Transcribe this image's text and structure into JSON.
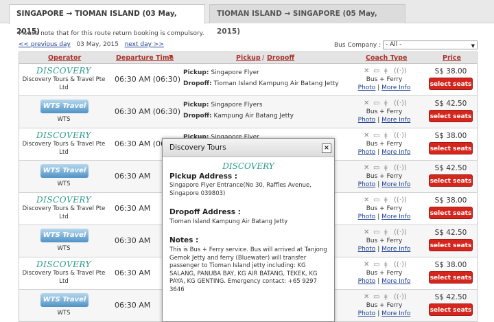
{
  "tabs": [
    {
      "label": "SINGAPORE → TIOMAN ISLAND (03 May, 2015)",
      "active": true
    },
    {
      "label": "TIOMAN ISLAND → SINGAPORE (05 May, 2015)",
      "active": false
    }
  ],
  "notice": "Please note that for this route return booking is compulsory.",
  "date_nav": {
    "prev": "<< previous day",
    "current": "03 May, 2015",
    "next": "next day >>"
  },
  "filter": {
    "label": "Bus Company :",
    "selected": "- All -"
  },
  "headers": {
    "operator": "Operator",
    "departure": "Departure Time",
    "pickup": "Pickup",
    "separator": "/",
    "dropoff": "Dropoff",
    "coach": "Coach Type",
    "price": "Price"
  },
  "labels": {
    "pickup": "Pickup:",
    "dropoff": "Dropoff:",
    "photo": "Photo",
    "more": "More Info",
    "divider": "|",
    "select": "select seats"
  },
  "rows": [
    {
      "logo": "DISCOVERY",
      "operator": "Discovery Tours & Travel Pte Ltd",
      "time": "06:30 AM (06:30)",
      "pickup": "Singapore Flyer",
      "dropoff": "Tioman Island Kampung Air Batang Jetty",
      "coach": "Bus + Ferry",
      "price": "S$ 38.00"
    },
    {
      "logo": "WTSTravel",
      "operator": "WTS",
      "time": "06:30 AM (06:30)",
      "pickup": "Singapore Flyers",
      "dropoff": "Kampung Air Batang Jetty",
      "coach": "Bus + Ferry",
      "price": "S$ 42.50"
    },
    {
      "logo": "DISCOVERY",
      "operator": "Discovery Tours & Travel Pte Ltd",
      "time": "06:30 AM (06:30)",
      "pickup": "Singapore Flyer",
      "dropoff": "",
      "coach": "Bus + Ferry",
      "price": "S$ 38.00"
    },
    {
      "logo": "WTSTravel",
      "operator": "WTS",
      "time": "06:30 AM",
      "pickup": "",
      "dropoff": "",
      "coach": "Bus + Ferry",
      "price": "S$ 42.50"
    },
    {
      "logo": "DISCOVERY",
      "operator": "Discovery Tours & Travel Pte Ltd",
      "time": "06:30 AM",
      "pickup": "",
      "dropoff": "",
      "coach": "Bus + Ferry",
      "price": "S$ 38.00"
    },
    {
      "logo": "WTSTravel",
      "operator": "WTS",
      "time": "06:30 AM",
      "pickup": "",
      "dropoff": "",
      "coach": "Bus + Ferry",
      "price": "S$ 42.50"
    },
    {
      "logo": "DISCOVERY",
      "operator": "Discovery Tours & Travel Pte Ltd",
      "time": "06:30 AM",
      "pickup": "",
      "dropoff": "",
      "coach": "Bus + Ferry",
      "price": "S$ 38.00"
    },
    {
      "logo": "WTSTravel",
      "operator": "WTS",
      "time": "06:30 AM",
      "pickup": "",
      "dropoff": "",
      "coach": "Bus + Ferry",
      "price": "S$ 42.50"
    }
  ],
  "popup": {
    "title": "Discovery Tours",
    "close": "×",
    "logo": "DISCOVERY",
    "pickup_heading": "Pickup Address :",
    "pickup_text": "Singapore Flyer Entrance(No 30, Raffles Avenue, Singapore 039803)",
    "dropoff_heading": "Dropoff Address :",
    "dropoff_text": "Tioman Island Kampung Air Batang Jetty",
    "notes_heading": "Notes :",
    "notes_text": "This is Bus + Ferry service. Bus will arrived at Tanjong Gemok Jetty and ferry (Bluewater) will transfer passenger to Tioman Island jetty including: KG SALANG, PANUBA BAY, KG AIR BATANG, TEKEK, KG PAYA, KG GENTING. Emergency contact: +65 9297 3646"
  },
  "colors": {
    "header_text": "#a8322b",
    "button": "#d4261d",
    "link": "#1a3d8f",
    "logo": "#2a9a8a"
  }
}
